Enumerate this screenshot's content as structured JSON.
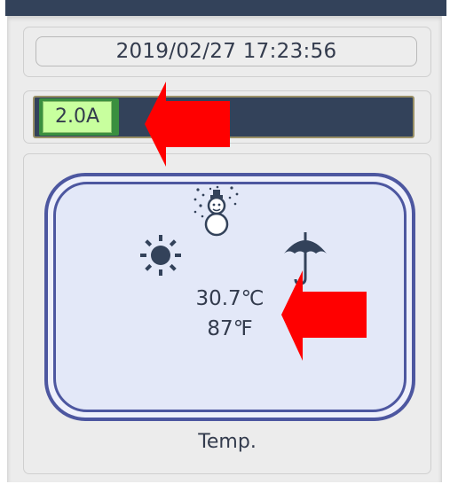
{
  "header": {
    "datetime": "2019/02/27 17:23:56"
  },
  "current_meter": {
    "label": "2.0A"
  },
  "temperature_panel": {
    "celsius": "30.7℃",
    "fahrenheit": "87℉",
    "caption": "Temp.",
    "icons": [
      "sun-icon",
      "snowman-icon",
      "umbrella-icon"
    ]
  },
  "colors": {
    "topbar": "#33425a",
    "frame": "#4d57a0",
    "meter_fill": "#3a8f3f",
    "meter_label_bg": "#c8ff9e",
    "annotation_arrow": "#ff0000"
  }
}
